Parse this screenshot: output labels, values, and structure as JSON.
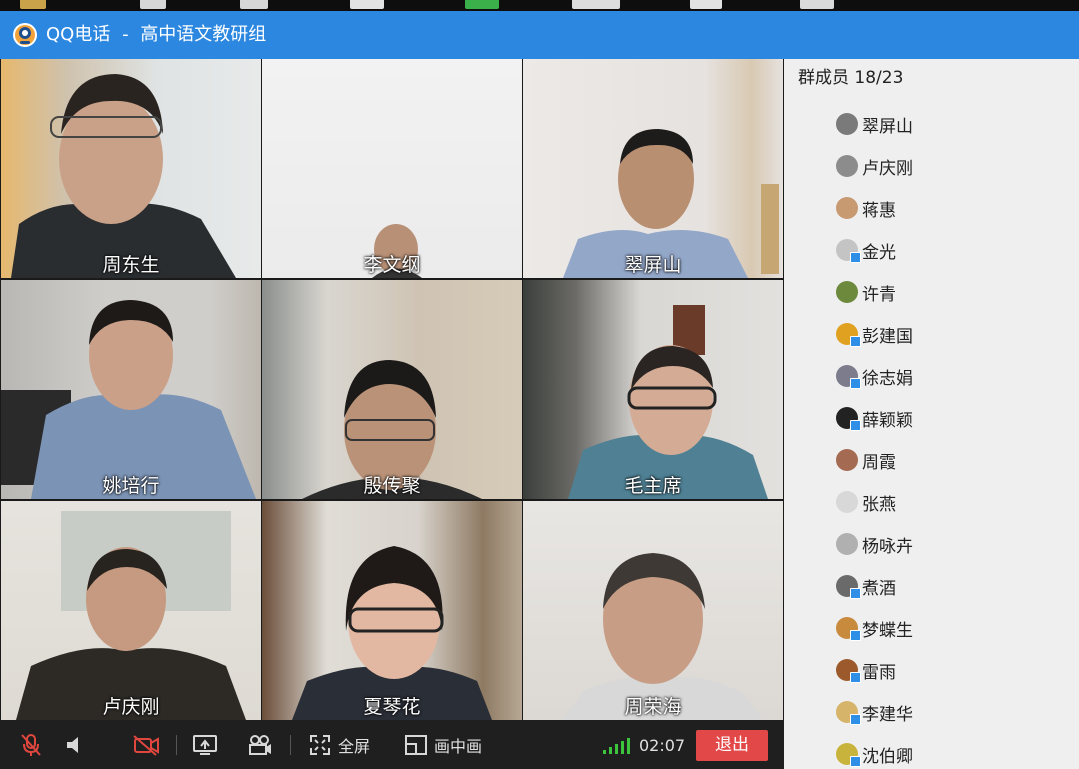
{
  "window": {
    "app_name": "QQ电话",
    "separator": "-",
    "group_name": "高中语文教研组"
  },
  "participants": [
    {
      "name": "周东生",
      "bg": "#d8dcdc"
    },
    {
      "name": "李文纲",
      "bg": "#eeeeee"
    },
    {
      "name": "翠屏山",
      "bg": "#e6e4e2"
    },
    {
      "name": "姚培行",
      "bg": "#c9c7c4"
    },
    {
      "name": "殷传聚",
      "bg": "#b9b0a4"
    },
    {
      "name": "毛主席",
      "bg": "#d4d2d0"
    },
    {
      "name": "卢庆刚",
      "bg": "#e4e2de"
    },
    {
      "name": "夏琴花",
      "bg": "#d6cfc6"
    },
    {
      "name": "周荣海",
      "bg": "#e2dedb"
    }
  ],
  "member_panel": {
    "header": "群成员 18/23",
    "members": [
      {
        "name": "翠屏山",
        "avatar_color": "#7a7a7a",
        "device": false
      },
      {
        "name": "卢庆刚",
        "avatar_color": "#8c8c8c",
        "device": false
      },
      {
        "name": "蒋惠",
        "avatar_color": "#c79a72",
        "device": false
      },
      {
        "name": "金光",
        "avatar_color": "#c4c4c4",
        "device": true
      },
      {
        "name": "许青",
        "avatar_color": "#6d8a3c",
        "device": false
      },
      {
        "name": "彭建国",
        "avatar_color": "#e0a020",
        "device": true
      },
      {
        "name": "徐志娟",
        "avatar_color": "#7c7c8c",
        "device": true
      },
      {
        "name": "薛颖颖",
        "avatar_color": "#222222",
        "device": true
      },
      {
        "name": "周霞",
        "avatar_color": "#a46b52",
        "device": false
      },
      {
        "name": "张燕",
        "avatar_color": "#d8d8d8",
        "device": false
      },
      {
        "name": "杨咏卉",
        "avatar_color": "#b0b0b0",
        "device": false
      },
      {
        "name": "煮酒",
        "avatar_color": "#6a6a6a",
        "device": true
      },
      {
        "name": "梦蝶生",
        "avatar_color": "#c88a3c",
        "device": true
      },
      {
        "name": "雷雨",
        "avatar_color": "#9c5a2c",
        "device": true
      },
      {
        "name": "李建华",
        "avatar_color": "#d6b46a",
        "device": true
      },
      {
        "name": "沈伯卿",
        "avatar_color": "#c8b43c",
        "device": true
      }
    ]
  },
  "toolbar": {
    "fullscreen_label": "全屏",
    "pip_label": "画中画",
    "timer": "02:07",
    "exit_label": "退出"
  },
  "colors": {
    "titlebar": "#2b87df",
    "exit_button": "#e34848",
    "muted_icon": "#e0473f",
    "signal": "#3cc43c"
  }
}
